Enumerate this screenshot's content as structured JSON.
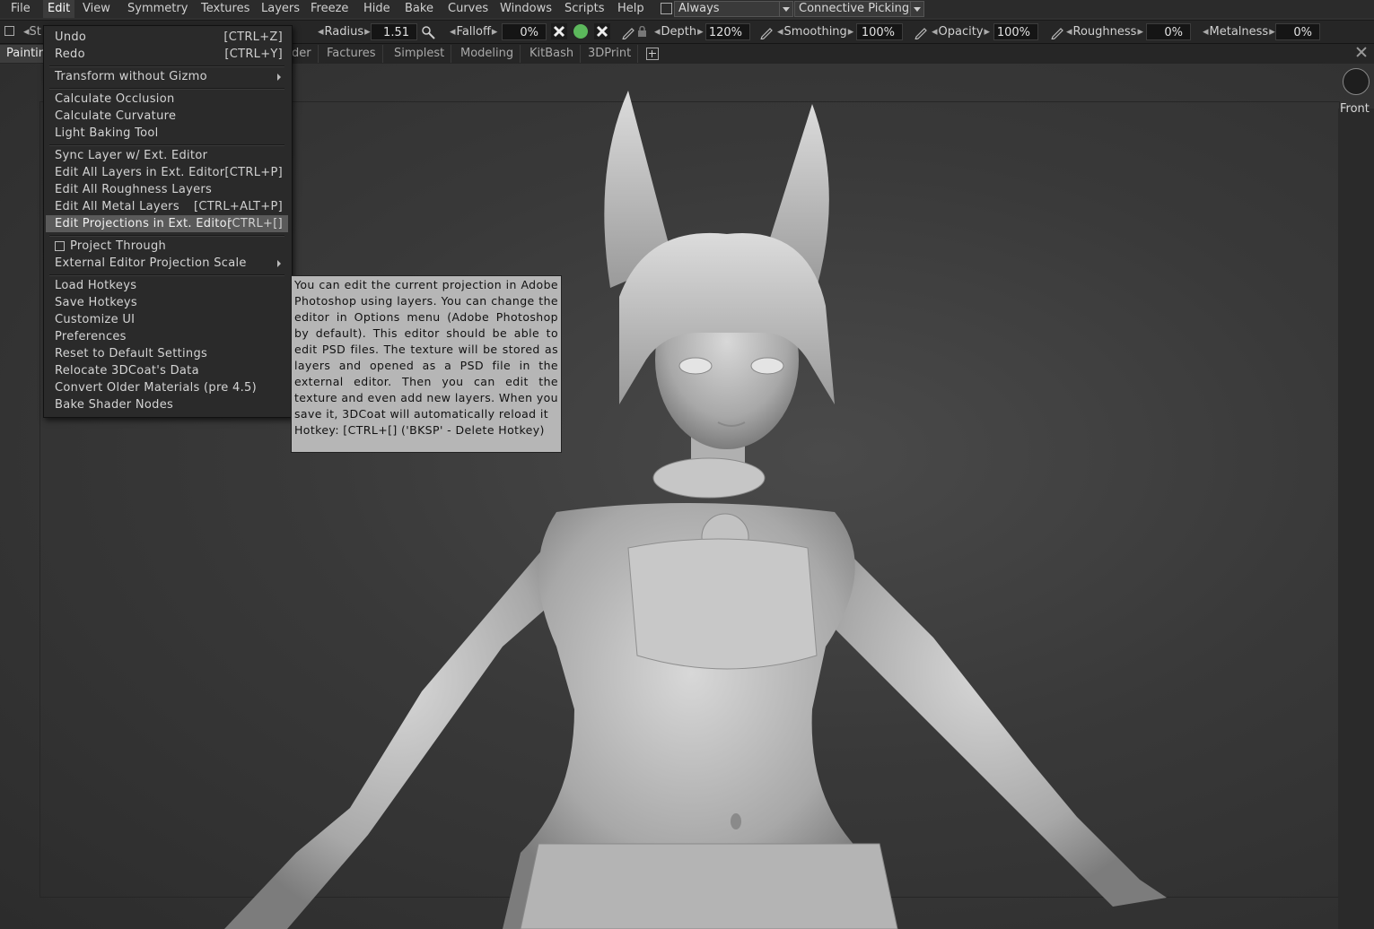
{
  "menubar": {
    "items": [
      "File",
      "Edit",
      "View",
      "Symmetry",
      "Textures",
      "Layers",
      "Freeze",
      "Hide",
      "Bake",
      "Curves",
      "Windows",
      "Scripts",
      "Help"
    ],
    "always_dropdown": "Always",
    "picking_dropdown": "Connective Picking"
  },
  "toolbar": {
    "radius_label": "Radius",
    "radius_value": "1.51",
    "falloff_label": "Falloff",
    "falloff_value": "0%",
    "depth_label": "Depth",
    "depth_value": "120%",
    "smoothing_label": "Smoothing",
    "smoothing_value": "100%",
    "opacity_label": "Opacity",
    "opacity_value": "100%",
    "roughness_label": "Roughness",
    "roughness_value": "0%",
    "metalness_label": "Metalness",
    "metalness_value": "0%",
    "partial_left": "St"
  },
  "tabs": [
    "Paintin",
    "der",
    "Factures",
    "Simplest",
    "Modeling",
    "KitBash",
    "3DPrint"
  ],
  "viewport": {
    "view_label": "Front"
  },
  "edit_menu": {
    "items": [
      {
        "label": "Undo",
        "shortcut": "[CTRL+Z]"
      },
      {
        "label": "Redo",
        "shortcut": "[CTRL+Y]"
      },
      {
        "label": "Transform without Gizmo"
      },
      {
        "label": "Calculate Occlusion"
      },
      {
        "label": "Calculate Curvature"
      },
      {
        "label": "Light Baking Tool"
      },
      {
        "label": "Sync Layer w/ Ext. Editor"
      },
      {
        "label": "Edit All Layers in Ext. Editor",
        "shortcut": "[CTRL+P]"
      },
      {
        "label": "Edit All Roughness Layers"
      },
      {
        "label": "Edit All Metal Layers",
        "shortcut": "[CTRL+ALT+P]"
      },
      {
        "label": "Edit Projections in Ext. Editor",
        "shortcut": "[CTRL+[]"
      },
      {
        "label": "Project Through"
      },
      {
        "label": "External Editor Projection Scale"
      },
      {
        "label": "Load Hotkeys"
      },
      {
        "label": "Save Hotkeys"
      },
      {
        "label": "Customize UI"
      },
      {
        "label": "Preferences"
      },
      {
        "label": "Reset to Default Settings"
      },
      {
        "label": "Relocate 3DCoat's Data"
      },
      {
        "label": "Convert Older Materials (pre 4.5)"
      },
      {
        "label": "Bake Shader Nodes"
      }
    ]
  },
  "tooltip": {
    "text": "You can edit the current projection in Adobe Photoshop using layers. You can change the editor in Options menu (Adobe Photoshop by default). This editor should be able to edit PSD files. The texture will be stored as layers and opened as a PSD file in the external editor. Then you can edit the texture and even add new layers. When you save it, 3DCoat will automatically reload it",
    "hotkey": "Hotkey: [CTRL+[]     ('BKSP' - Delete Hotkey)"
  },
  "colors": {
    "menu_bg": "#2a2a2a",
    "highlight": "#5a5a5a",
    "tooltip_bg": "#b6b6b6",
    "green_button": "#5cb85c"
  }
}
